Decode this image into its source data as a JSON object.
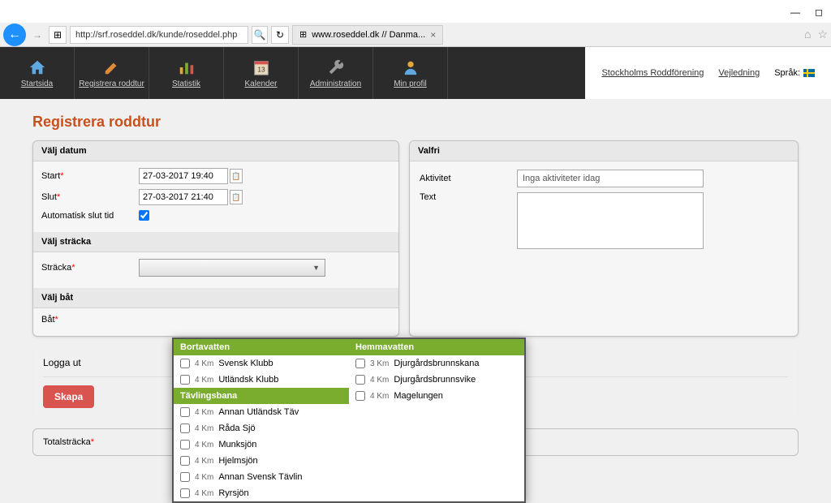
{
  "browser": {
    "url": "http://srf.roseddel.dk/kunde/roseddel.php",
    "tab_title": "www.roseddel.dk // Danma..."
  },
  "nav": {
    "items": [
      {
        "label": "Startsida"
      },
      {
        "label": "Registrera roddtur"
      },
      {
        "label": "Statistik"
      },
      {
        "label": "Kalender"
      },
      {
        "label": "Administration"
      },
      {
        "label": "Min profil"
      }
    ],
    "club": "Stockholms Roddförening",
    "help": "Vejledning",
    "lang_label": "Språk:"
  },
  "page": {
    "title": "Registrera roddtur",
    "sections": {
      "valj_datum": "Välj datum",
      "valj_stracka": "Välj sträcka",
      "valj_bat": "Välj båt",
      "valfri": "Valfri"
    },
    "fields": {
      "start_label": "Start",
      "start_value": "27-03-2017 19:40",
      "slut_label": "Slut",
      "slut_value": "27-03-2017 21:40",
      "auto_slut_label": "Automatisk slut tid",
      "stracka_label": "Sträcka",
      "bat_label": "Båt",
      "aktivitet_label": "Aktivitet",
      "aktivitet_value": "Inga aktiviteter idag",
      "text_label": "Text"
    },
    "logout_label": "Logga ut",
    "skapa_label": "Skapa",
    "total_label": "Totalsträcka"
  },
  "dropdown": {
    "columns": [
      {
        "groups": [
          {
            "header": "Bortavatten",
            "items": [
              {
                "km": "4 Km",
                "name": "Svensk Klubb"
              },
              {
                "km": "4 Km",
                "name": "Utländsk Klubb"
              }
            ]
          },
          {
            "header": "Tävlingsbana",
            "items": [
              {
                "km": "4 Km",
                "name": "Annan Utländsk Täv"
              },
              {
                "km": "4 Km",
                "name": "Råda Sjö"
              },
              {
                "km": "4 Km",
                "name": "Munksjön"
              },
              {
                "km": "4 Km",
                "name": "Hjelmsjön"
              },
              {
                "km": "4 Km",
                "name": "Annan Svensk Tävlin"
              },
              {
                "km": "4 Km",
                "name": "Ryrsjön"
              }
            ]
          }
        ]
      },
      {
        "groups": [
          {
            "header": "Hemmavatten",
            "items": [
              {
                "km": "3 Km",
                "name": "Djurgårdsbrunnskana"
              },
              {
                "km": "4 Km",
                "name": "Djurgårdsbrunnsvike"
              },
              {
                "km": "4 Km",
                "name": "Magelungen"
              }
            ]
          }
        ]
      }
    ]
  }
}
